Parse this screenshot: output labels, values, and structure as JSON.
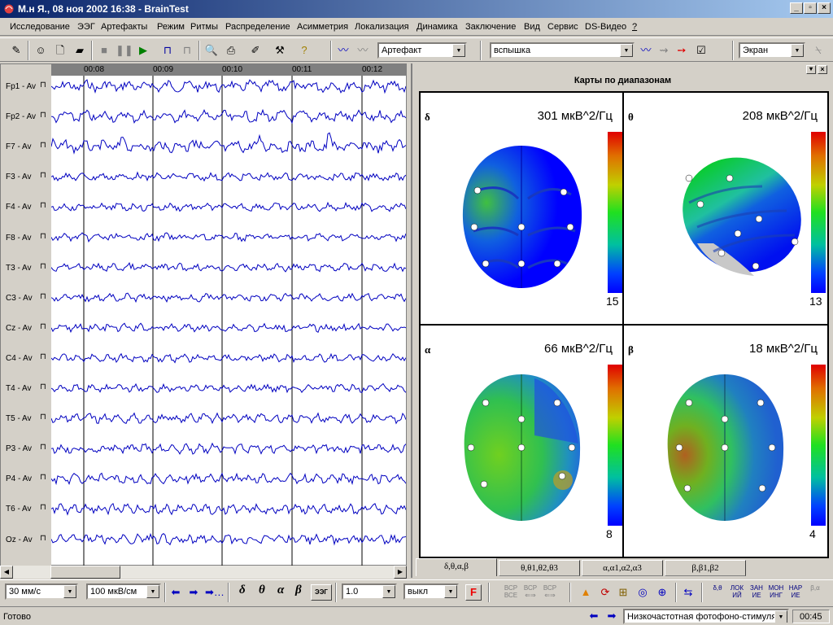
{
  "window": {
    "title": "М.н Я., 08 ноя 2002 16:38 - BrainTest"
  },
  "menu": [
    "Исследование",
    "ЭЭГ",
    "Артефакты",
    "Режим",
    "Ритмы",
    "Распределение",
    "Асимметрия",
    "Локализация",
    "Динамика",
    "Заключение",
    "Вид",
    "Сервис",
    "DS-Видео",
    "?"
  ],
  "toolbar": {
    "artifact_combo": "Артефакт",
    "stimulus_combo": "вспышка",
    "screen_combo": "Экран"
  },
  "eeg": {
    "time_marks": [
      "00:08",
      "00:09",
      "00:10",
      "00:11",
      "00:12"
    ],
    "channels": [
      "Fp1 - Av",
      "Fp2 - Av",
      "F7 - Av",
      "F3 - Av",
      "F4 - Av",
      "F8 - Av",
      "T3 - Av",
      "C3 - Av",
      "Cz - Av",
      "C4 - Av",
      "T4 - Av",
      "T5 - Av",
      "P3 - Av",
      "P4 - Av",
      "T6 - Av",
      "Oz - Av"
    ],
    "trace_color": "#0000c0"
  },
  "maps": {
    "panel_title": "Карты по диапазонам",
    "quadrants": [
      {
        "greek": "δ",
        "value": "301 мкВ^2/Гц",
        "min": "15"
      },
      {
        "greek": "θ",
        "value": "208 мкВ^2/Гц",
        "min": "13"
      },
      {
        "greek": "α",
        "value": "66 мкВ^2/Гц",
        "min": "8"
      },
      {
        "greek": "β",
        "value": "18 мкВ^2/Гц",
        "min": "4"
      }
    ],
    "tabs": [
      "δ,θ,α,β",
      "θ,θ1,θ2,θ3",
      "α,α1,α2,α3",
      "β,β1,β2"
    ]
  },
  "bottom": {
    "speed_combo": "30 мм/с",
    "amp_combo": "100 мкВ/см",
    "gain_combo": "1.0",
    "filter_combo": "выкл",
    "f_button": "F",
    "eeg_button": "ЭЭГ",
    "greek": [
      "δ",
      "θ",
      "α",
      "β"
    ],
    "vsp_labels": [
      "ВСР ВСЕ",
      "ВСР ⇐⇒",
      "ВСР ⇐⇒"
    ],
    "band_buttons": [
      "δ,θ",
      "ЛОК ИЙ",
      "ЗАН ИЕ",
      "МОН ИНГ",
      "НАР ИЕ",
      "β,α"
    ]
  },
  "status": {
    "ready": "Готово",
    "stim_combo": "Низкочастотная фотофоно-стимуля",
    "time": "00:45"
  }
}
